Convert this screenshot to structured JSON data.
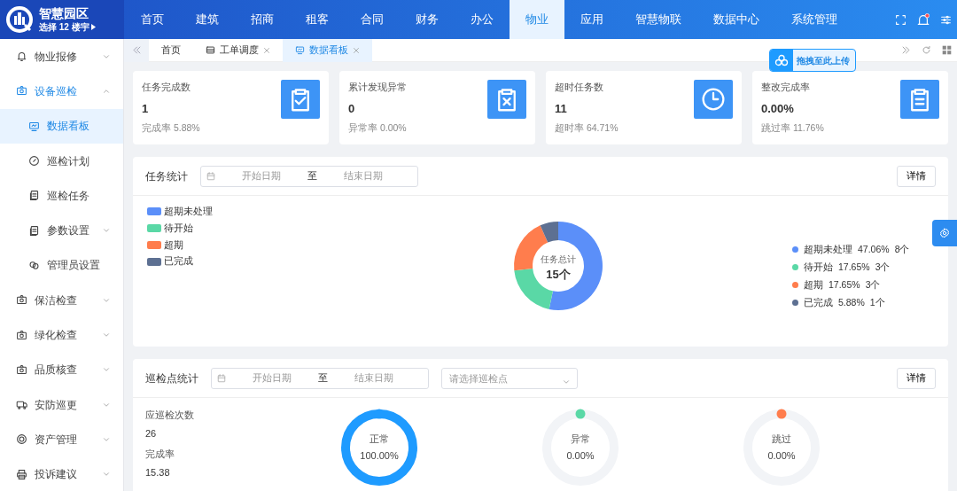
{
  "header": {
    "logo_title": "智慧园区",
    "building_selector": "选择 12 楼宇",
    "notification_unread": true,
    "nav": [
      {
        "label": "首页",
        "selected": false
      },
      {
        "label": "建筑",
        "selected": false
      },
      {
        "label": "招商",
        "selected": false
      },
      {
        "label": "租客",
        "selected": false
      },
      {
        "label": "合同",
        "selected": false
      },
      {
        "label": "财务",
        "selected": false
      },
      {
        "label": "办公",
        "selected": false
      },
      {
        "label": "物业",
        "selected": true
      },
      {
        "label": "应用",
        "selected": false
      },
      {
        "label": "智慧物联",
        "selected": false
      },
      {
        "label": "数据中心",
        "selected": false
      },
      {
        "label": "系统管理",
        "selected": false
      }
    ]
  },
  "sidebar": {
    "items": [
      {
        "label": "物业报修",
        "kind": "group",
        "expanded": false,
        "selected": false
      },
      {
        "label": "设备巡检",
        "kind": "group",
        "expanded": true,
        "selected": false,
        "children": [
          {
            "label": "数据看板",
            "kind": "link",
            "selected": true
          },
          {
            "label": "巡检计划",
            "kind": "link",
            "selected": false
          },
          {
            "label": "巡检任务",
            "kind": "link",
            "selected": false
          },
          {
            "label": "参数设置",
            "kind": "group",
            "expanded": false,
            "selected": false
          },
          {
            "label": "管理员设置",
            "kind": "link",
            "selected": false
          }
        ]
      },
      {
        "label": "保洁检查",
        "kind": "group",
        "expanded": false,
        "selected": false
      },
      {
        "label": "绿化检查",
        "kind": "group",
        "expanded": false,
        "selected": false
      },
      {
        "label": "品质核查",
        "kind": "group",
        "expanded": false,
        "selected": false
      },
      {
        "label": "安防巡更",
        "kind": "group",
        "expanded": false,
        "selected": false
      },
      {
        "label": "资产管理",
        "kind": "group",
        "expanded": false,
        "selected": false
      },
      {
        "label": "投诉建议",
        "kind": "group",
        "expanded": false,
        "selected": false
      }
    ]
  },
  "tabs": [
    {
      "label": "首页",
      "selected": false,
      "closable": false
    },
    {
      "label": "工单调度",
      "selected": false,
      "closable": true
    },
    {
      "label": "数据看板",
      "selected": true,
      "closable": true
    }
  ],
  "upload_button": "拖拽至此上传",
  "stats": [
    {
      "title": "任务完成数",
      "value": "1",
      "footer": "完成率 5.88%"
    },
    {
      "title": "累计发现异常",
      "value": "0",
      "footer": "异常率 0.00%"
    },
    {
      "title": "超时任务数",
      "value": "11",
      "footer": "超时率 64.71%"
    },
    {
      "title": "整改完成率",
      "value": "0.00%",
      "footer": "跳过率 11.76%"
    }
  ],
  "task_stats": {
    "title": "任务统计",
    "start_placeholder": "开始日期",
    "separator": "至",
    "end_placeholder": "结束日期",
    "details_button": "详情",
    "center_label": "任务总计",
    "center_value": "15个",
    "chart_data": {
      "type": "donut",
      "categories": [
        "超期未处理",
        "待开始",
        "超期",
        "已完成"
      ],
      "values": [
        53.33,
        20,
        20,
        6.67
      ]
    },
    "legend": [
      {
        "color": "#5b8ff9"
      },
      {
        "color": "#5ad8a6"
      },
      {
        "color": "#ff7d4d"
      },
      {
        "color": "#5d7092"
      }
    ],
    "breakdown": [
      {
        "label": "超期未处理",
        "percent": "47.06%",
        "count": "8个",
        "color": "#5b8ff9"
      },
      {
        "label": "待开始",
        "percent": "17.65%",
        "count": "3个",
        "color": "#5ad8a6"
      },
      {
        "label": "超期",
        "percent": "17.65%",
        "count": "3个",
        "color": "#ff7d4d"
      },
      {
        "label": "已完成",
        "percent": "5.88%",
        "count": "1个",
        "color": "#5d7092"
      }
    ]
  },
  "patrol_stats": {
    "title": "巡检点统计",
    "start_placeholder": "开始日期",
    "separator": "至",
    "end_placeholder": "结束日期",
    "select_placeholder": "请选择巡检点",
    "details_button": "详情",
    "summary": [
      {
        "label": "应巡检次数",
        "value": "26"
      },
      {
        "label": "完成率",
        "value": "15.38"
      }
    ],
    "gauges": [
      {
        "label": "正常",
        "value": "100.00%",
        "level": 1,
        "color": "#1e9bff"
      },
      {
        "label": "异常",
        "value": "0.00%",
        "level": 0,
        "color": "#5ad8a6"
      },
      {
        "label": "跳过",
        "value": "0.00%",
        "level": 0,
        "color": "#ff7d4d"
      }
    ]
  }
}
